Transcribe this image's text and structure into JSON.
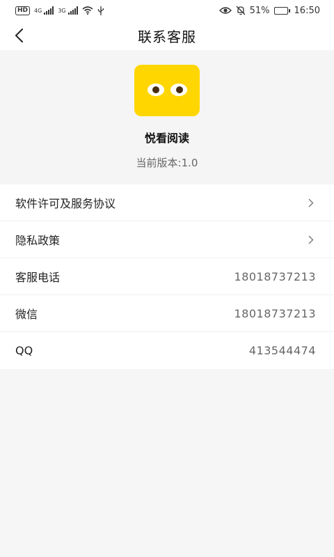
{
  "status_bar": {
    "left_badge": "HD",
    "net1": "4G",
    "net2": "3G",
    "battery_text": "51%",
    "battery_level": 0.51,
    "time": "16:50"
  },
  "header": {
    "title": "联系客服"
  },
  "app": {
    "name": "悦看阅读",
    "version": "当前版本:1.0",
    "logo_color": "#ffd600"
  },
  "menu": {
    "license_label": "软件许可及服务协议",
    "privacy_label": "隐私政策",
    "phone_label": "客服电话",
    "phone_value": "18018737213",
    "wechat_label": "微信",
    "wechat_value": "18018737213",
    "qq_label": "QQ",
    "qq_value": "413544474"
  }
}
